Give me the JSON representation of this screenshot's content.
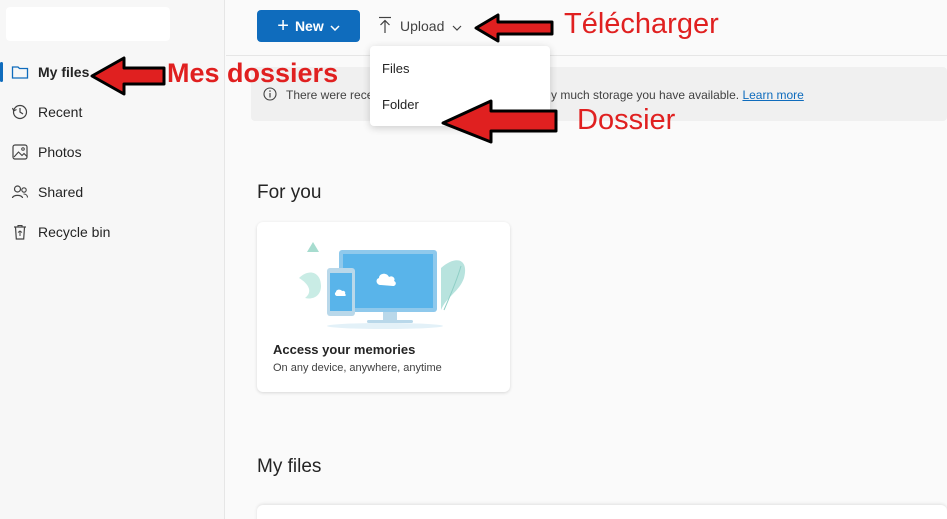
{
  "toolbar": {
    "new_label": "New",
    "upload_label": "Upload"
  },
  "upload_menu": {
    "items": [
      {
        "label": "Files"
      },
      {
        "label": "Folder"
      }
    ]
  },
  "sidebar": {
    "items": [
      {
        "label": "My files",
        "icon": "folder-icon",
        "active": true
      },
      {
        "label": "Recent",
        "icon": "history-icon"
      },
      {
        "label": "Photos",
        "icon": "image-icon"
      },
      {
        "label": "Shared",
        "icon": "people-icon"
      },
      {
        "label": "Recycle bin",
        "icon": "recycle-bin-icon"
      }
    ]
  },
  "banner": {
    "text_start": "There were rece",
    "text_end": "y much storage you have available.",
    "link": "Learn more"
  },
  "for_you": {
    "title": "For you",
    "card": {
      "title": "Access your memories",
      "subtitle": "On any device, anywhere, anytime"
    }
  },
  "my_files": {
    "title": "My files"
  },
  "annotations": {
    "upload": "Télécharger",
    "my_files": "Mes dossiers",
    "folder": "Dossier"
  },
  "colors": {
    "accent": "#0f6cbd",
    "annotation": "#e02020"
  }
}
